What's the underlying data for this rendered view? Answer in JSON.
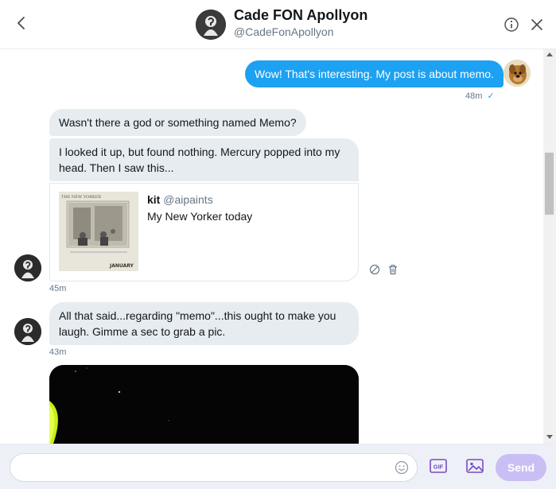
{
  "header": {
    "name": "Cade FON Apollyon",
    "handle": "@CadeFonApollyon"
  },
  "messages": {
    "outgoing_1": {
      "text": "Wow! That's interesting. My post is about memo.",
      "time": "48m",
      "status_glyph": "✓"
    },
    "incoming_1": {
      "text": "Wasn't there a god or something named Memo?"
    },
    "incoming_2": {
      "line1": "I looked it up, but found nothing. Mercury popped into my",
      "line2": "head. Then I saw this..."
    },
    "tweet_card": {
      "author_name": "kit",
      "author_handle": "@aipaints",
      "text": "My New Yorker today",
      "thumb_masthead": "THE NEW YORKER",
      "thumb_month": "JANUARY"
    },
    "group_1_time": "45m",
    "incoming_3": {
      "line1": "All that said...regarding \"memo\"...this ought to make you",
      "line2": "laugh. Gimme a sec to grab a pic."
    },
    "group_2_time": "43m"
  },
  "composer": {
    "input_value": "",
    "gif_label": "GIF",
    "send_label": "Send"
  },
  "colors": {
    "accent": "#1da1f2",
    "send_disabled": "#c9bff4",
    "incoming_bubble": "#e6ecf0",
    "icon_purple": "#794bc4"
  },
  "icons": {
    "back": "chevron-left-icon",
    "info": "info-icon",
    "close": "close-icon",
    "emoji": "emoji-icon",
    "gif": "gif-icon",
    "media": "image-icon",
    "report": "report-icon",
    "delete": "trash-icon"
  }
}
